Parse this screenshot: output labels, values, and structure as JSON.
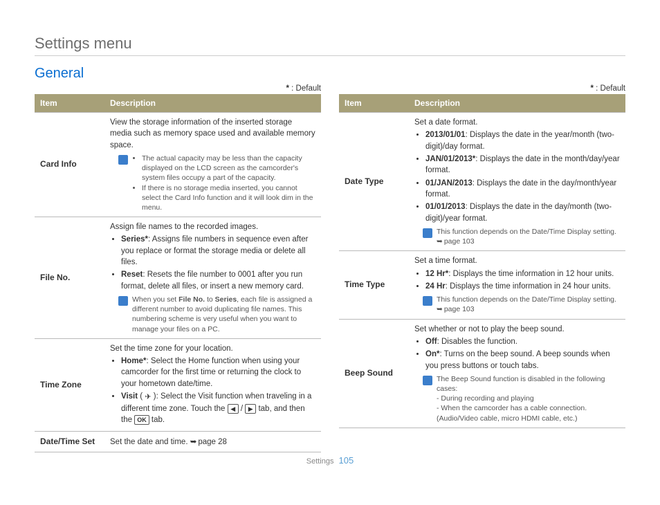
{
  "page_title": "Settings menu",
  "section_title": "General",
  "default_label": "* : Default",
  "headers": {
    "item": "Item",
    "desc": "Description"
  },
  "note_glyph": " ",
  "left": {
    "card_info": {
      "name": "Card Info",
      "intro": "View the storage information of the inserted storage media such as memory space used and available memory space.",
      "note1": "The actual capacity may be less than the capacity displayed on the LCD screen as the camcorder's system files occupy a part of the capacity.",
      "note2": "If there is no storage media inserted, you cannot select the Card Info function and it will look dim in the menu."
    },
    "file_no": {
      "name": "File No.",
      "intro": "Assign file names to the recorded images.",
      "opt1_label": "Series*",
      "opt1_text": ": Assigns file numbers in sequence even after you replace or format the storage media or delete all files.",
      "opt2_label": "Reset",
      "opt2_text": ": Resets the file number to 0001 after you run format, delete all files, or insert a new memory card.",
      "note_pre": "When you set ",
      "note_b1": "File No.",
      "note_mid": " to ",
      "note_b2": "Series",
      "note_post": ", each file is assigned a different number to avoid duplicating file names. This numbering scheme is very useful when you want to manage your files on a PC."
    },
    "time_zone": {
      "name": "Time Zone",
      "intro": "Set the time zone for your location.",
      "opt1_label": "Home*",
      "opt1_text": ": Select the Home function when using your camcorder for the first time or returning the clock to your hometown date/time.",
      "opt2_label": "Visit",
      "opt2_icon": "✈",
      "opt2_text_a": "): Select the Visit function when traveling in a different time zone. Touch the ",
      "opt2_text_b": " tab, and then the ",
      "opt2_text_c": " tab."
    },
    "date_time_set": {
      "name": "Date/Time Set",
      "text": "Set the date and time. ",
      "link": "page 28"
    }
  },
  "right": {
    "date_type": {
      "name": "Date Type",
      "intro": "Set a date format.",
      "o1_label": "2013/01/01",
      "o1_text": ": Displays the date in the year/month (two-digit)/day format.",
      "o2_label": "JAN/01/2013*",
      "o2_text": ": Displays the date in the month/day/year format.",
      "o3_label": "01/JAN/2013",
      "o3_text": ": Displays the date in the day/month/year format.",
      "o4_label": "01/01/2013",
      "o4_text": ": Displays the date in the day/month (two-digit)/year format.",
      "note": "This function depends on the Date/Time Display setting.",
      "note_link": "page 103"
    },
    "time_type": {
      "name": "Time Type",
      "intro": "Set a time format.",
      "o1_label": "12 Hr*",
      "o1_text": ": Displays the time information in 12 hour units.",
      "o2_label": "24 Hr",
      "o2_text": ": Displays the time information in 24 hour units.",
      "note": "This function depends on the Date/Time Display setting.",
      "note_link": "page 103"
    },
    "beep": {
      "name": "Beep Sound",
      "intro": "Set whether or not to play the beep sound.",
      "o1_label": "Off",
      "o1_text": ": Disables the function.",
      "o2_label": "On*",
      "o2_text": ": Turns on the beep sound. A beep sounds when you press buttons or touch tabs.",
      "note_head": "The Beep Sound function is disabled in the following cases:",
      "note_l1": "- During recording and playing",
      "note_l2": "- When the camcorder has a cable connection. (Audio/Video cable, micro HDMI cable, etc.)"
    }
  },
  "footer": {
    "section": "Settings",
    "page": "105"
  },
  "ok_label": "OK",
  "arrow_left": "◀",
  "arrow_right": "▶"
}
